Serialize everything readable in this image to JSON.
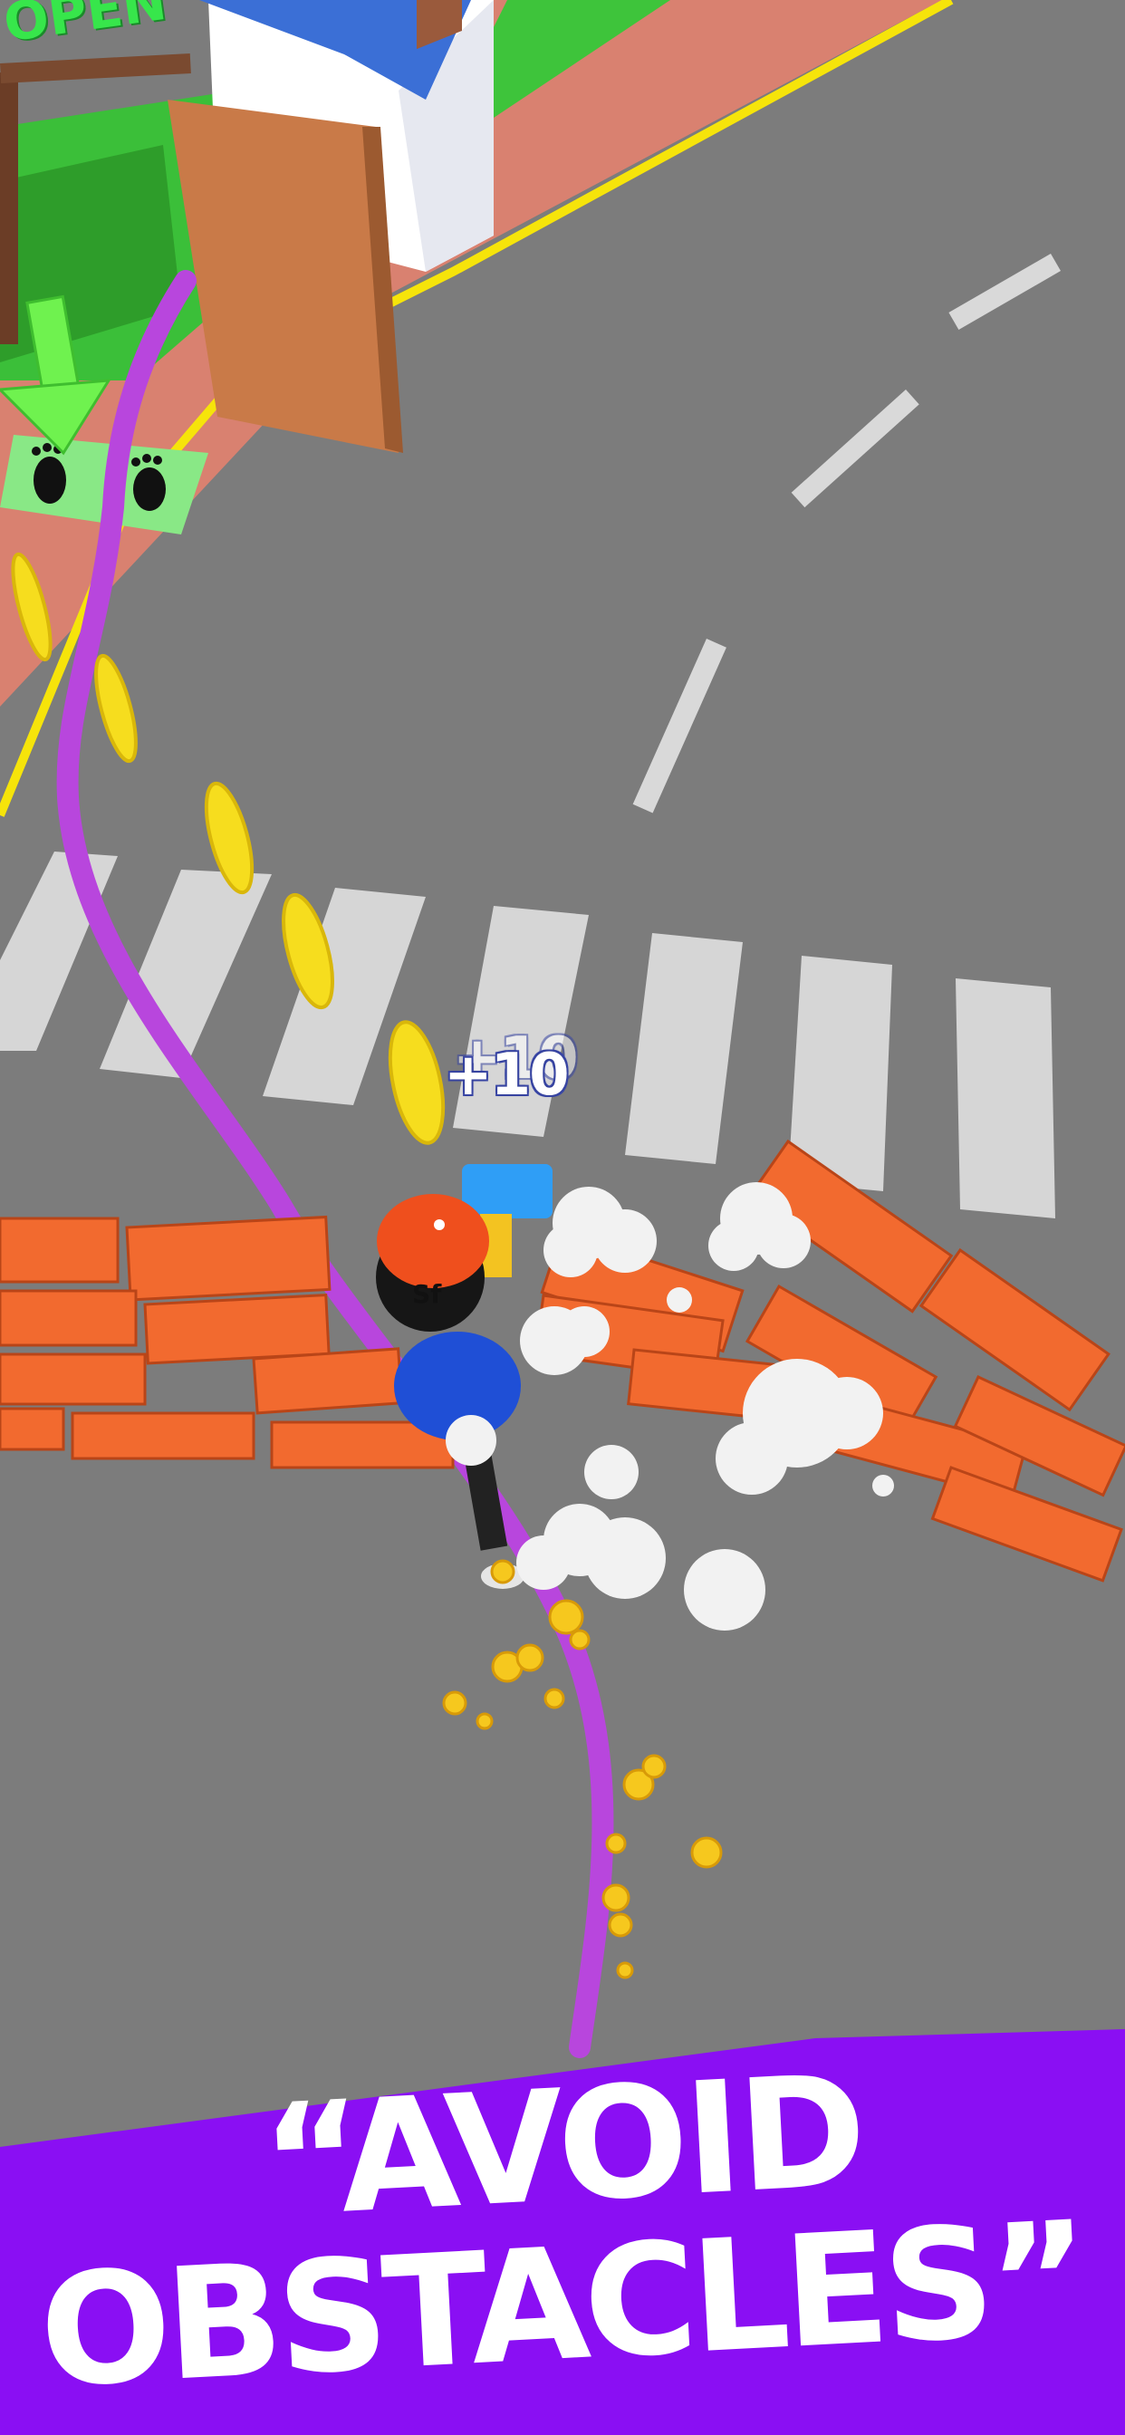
{
  "shop": {
    "sign_text": "OPEN"
  },
  "hud": {
    "score_popups": [
      "+10",
      "+10"
    ]
  },
  "banner": {
    "line1": "“AVOID",
    "line2": "OBSTACLES”"
  },
  "colors": {
    "road": "#7c7c7c",
    "sidewalk": "#d97f6c",
    "grass": "#39c33a",
    "path": "#b845dd",
    "coin": "#f6dd1e",
    "brick": "#f26a2f",
    "banner": "#8a0ff3",
    "crosswalk": "#d7d7d7"
  },
  "icons": [
    "footprints-icon",
    "down-arrow-icon",
    "coin-icon",
    "dust-cloud-icon"
  ]
}
